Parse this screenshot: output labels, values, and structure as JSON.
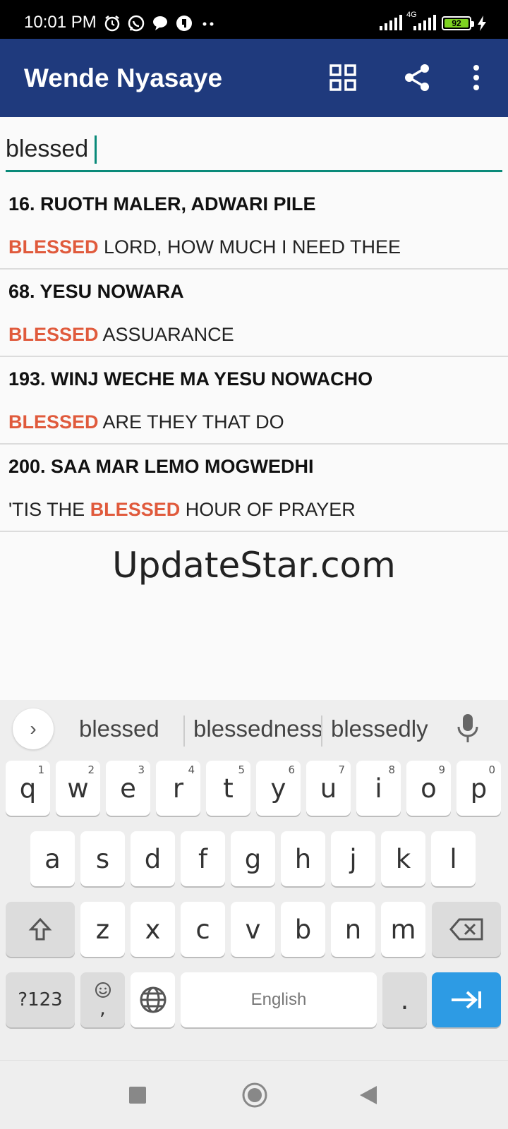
{
  "status_bar": {
    "time": "10:01 PM",
    "network": "4G",
    "battery": "92"
  },
  "app_bar": {
    "title": "Wende Nyasaye"
  },
  "search": {
    "value": "blessed"
  },
  "results": [
    {
      "title": "16. RUOTH MALER, ADWARI PILE",
      "pre": "",
      "highlight": "BLESSED",
      "post": " LORD, HOW MUCH I NEED THEE"
    },
    {
      "title": "68. YESU NOWARA",
      "pre": "",
      "highlight": "BLESSED",
      "post": " ASSUARANCE"
    },
    {
      "title": "193. WINJ WECHE MA YESU NOWACHO",
      "pre": "",
      "highlight": "BLESSED",
      "post": " ARE THEY THAT DO"
    },
    {
      "title": "200. SAA MAR LEMO MOGWEDHI",
      "pre": "'TIS THE ",
      "highlight": "BLESSED",
      "post": " HOUR OF PRAYER"
    }
  ],
  "watermark": "UpdateStar.com",
  "keyboard": {
    "suggestions": [
      "blessed",
      "blessedness",
      "blessedly"
    ],
    "row1": [
      "q",
      "w",
      "e",
      "r",
      "t",
      "y",
      "u",
      "i",
      "o",
      "p"
    ],
    "row1_hints": [
      "1",
      "2",
      "3",
      "4",
      "5",
      "6",
      "7",
      "8",
      "9",
      "0"
    ],
    "row2": [
      "a",
      "s",
      "d",
      "f",
      "g",
      "h",
      "j",
      "k",
      "l"
    ],
    "row3": [
      "z",
      "x",
      "c",
      "v",
      "b",
      "n",
      "m"
    ],
    "symbols_label": "?123",
    "comma_label": ",",
    "space_label": "English",
    "period_label": ".",
    "accent_color": "#2d9be4"
  },
  "colors": {
    "app_bar": "#1f3a7d",
    "highlight": "#e05a3c",
    "search_underline": "#0a8a79"
  }
}
